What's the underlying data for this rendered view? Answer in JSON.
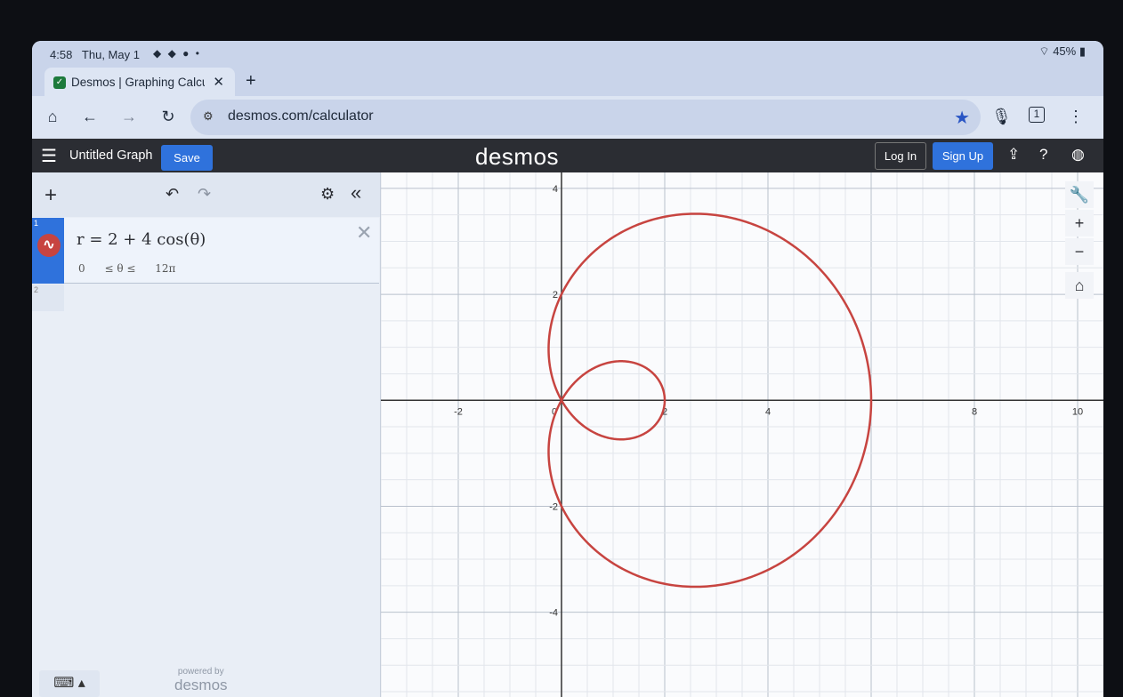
{
  "status_bar": {
    "time": "4:58",
    "date": "Thu, May 1",
    "battery": "45%"
  },
  "browser": {
    "tab_title": "Desmos | Graphing Calcul",
    "url": "desmos.com/calculator",
    "icons": [
      "home-icon",
      "back-icon",
      "forward-icon",
      "reload-icon",
      "site-settings-icon",
      "star-icon",
      "mic-icon",
      "tab-count-icon",
      "more-icon"
    ],
    "tab_count": "1"
  },
  "header": {
    "graph_title": "Untitled Graph",
    "save_label": "Save",
    "logo": "desmos",
    "login_label": "Log In",
    "signup_label": "Sign Up"
  },
  "expressions": {
    "items": [
      {
        "index": "1",
        "formula": "r = 2 + 4 cos(θ)",
        "domain_min": "0",
        "domain_op": "≤ θ ≤",
        "domain_max": "12π",
        "color": "#c74440"
      },
      {
        "index": "2"
      }
    ]
  },
  "footer": {
    "powered_by": "powered by",
    "brand": "desmos"
  },
  "graph": {
    "x_ticks": [
      "-2",
      "0",
      "2",
      "4",
      "8",
      "10"
    ],
    "y_ticks": [
      "4",
      "2",
      "-2",
      "-4"
    ],
    "xlim": [
      -3.5,
      10.5
    ],
    "ylim": [
      -5.6,
      4.3
    ],
    "curve": {
      "type": "polar",
      "a": 2,
      "b": 4,
      "theta_max_pi": 12,
      "color": "#c74440"
    }
  }
}
